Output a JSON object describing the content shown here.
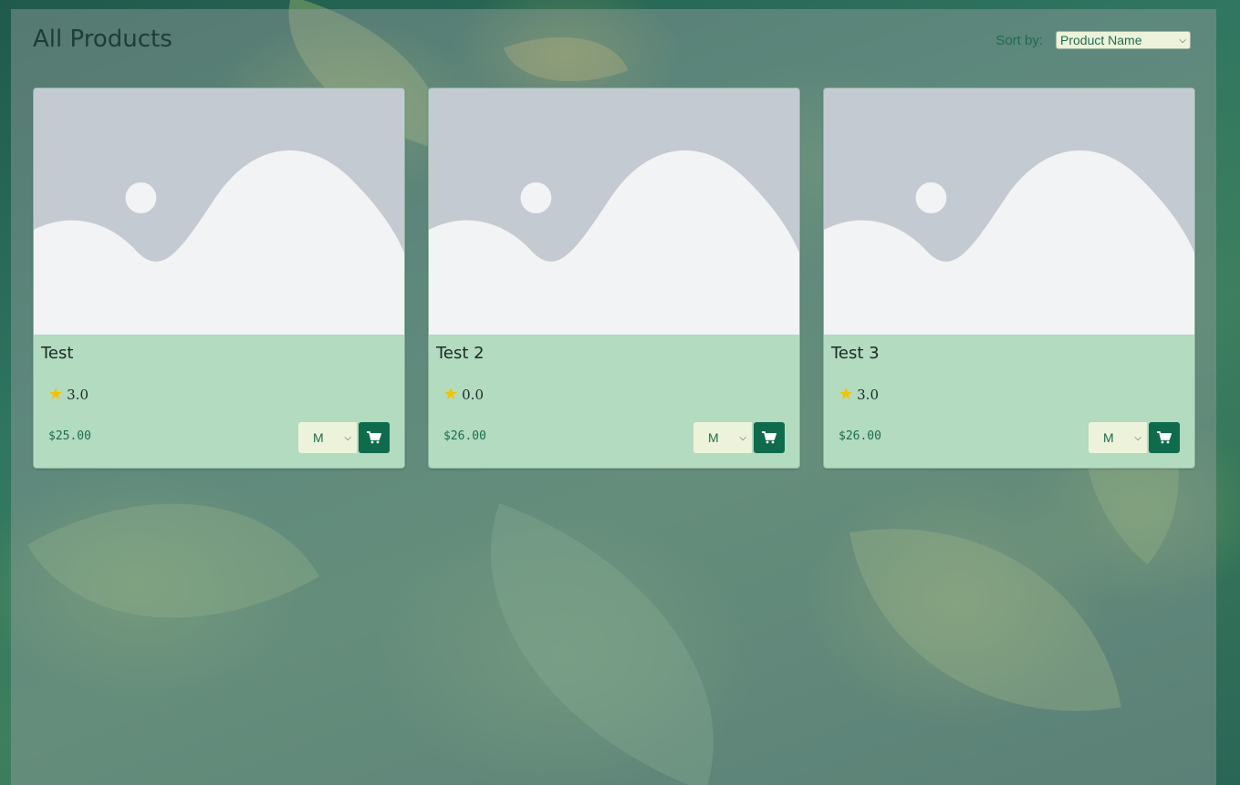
{
  "page": {
    "title": "All Products",
    "sort_label": "Sort by:",
    "sort_value": "Product Name"
  },
  "colors": {
    "accent": "#0f6b4c",
    "card_bg": "#b2dbc0",
    "star": "#f2c200"
  },
  "products": [
    {
      "name": "Test",
      "rating": "3.0",
      "price": "$25.00",
      "size": "M"
    },
    {
      "name": "Test 2",
      "rating": "0.0",
      "price": "$26.00",
      "size": "M"
    },
    {
      "name": "Test 3",
      "rating": "3.0",
      "price": "$26.00",
      "size": "M"
    }
  ],
  "icons": {
    "star": "star-icon",
    "cart": "cart-icon",
    "placeholder": "image-placeholder-icon",
    "chevron": "chevron-down-icon"
  }
}
